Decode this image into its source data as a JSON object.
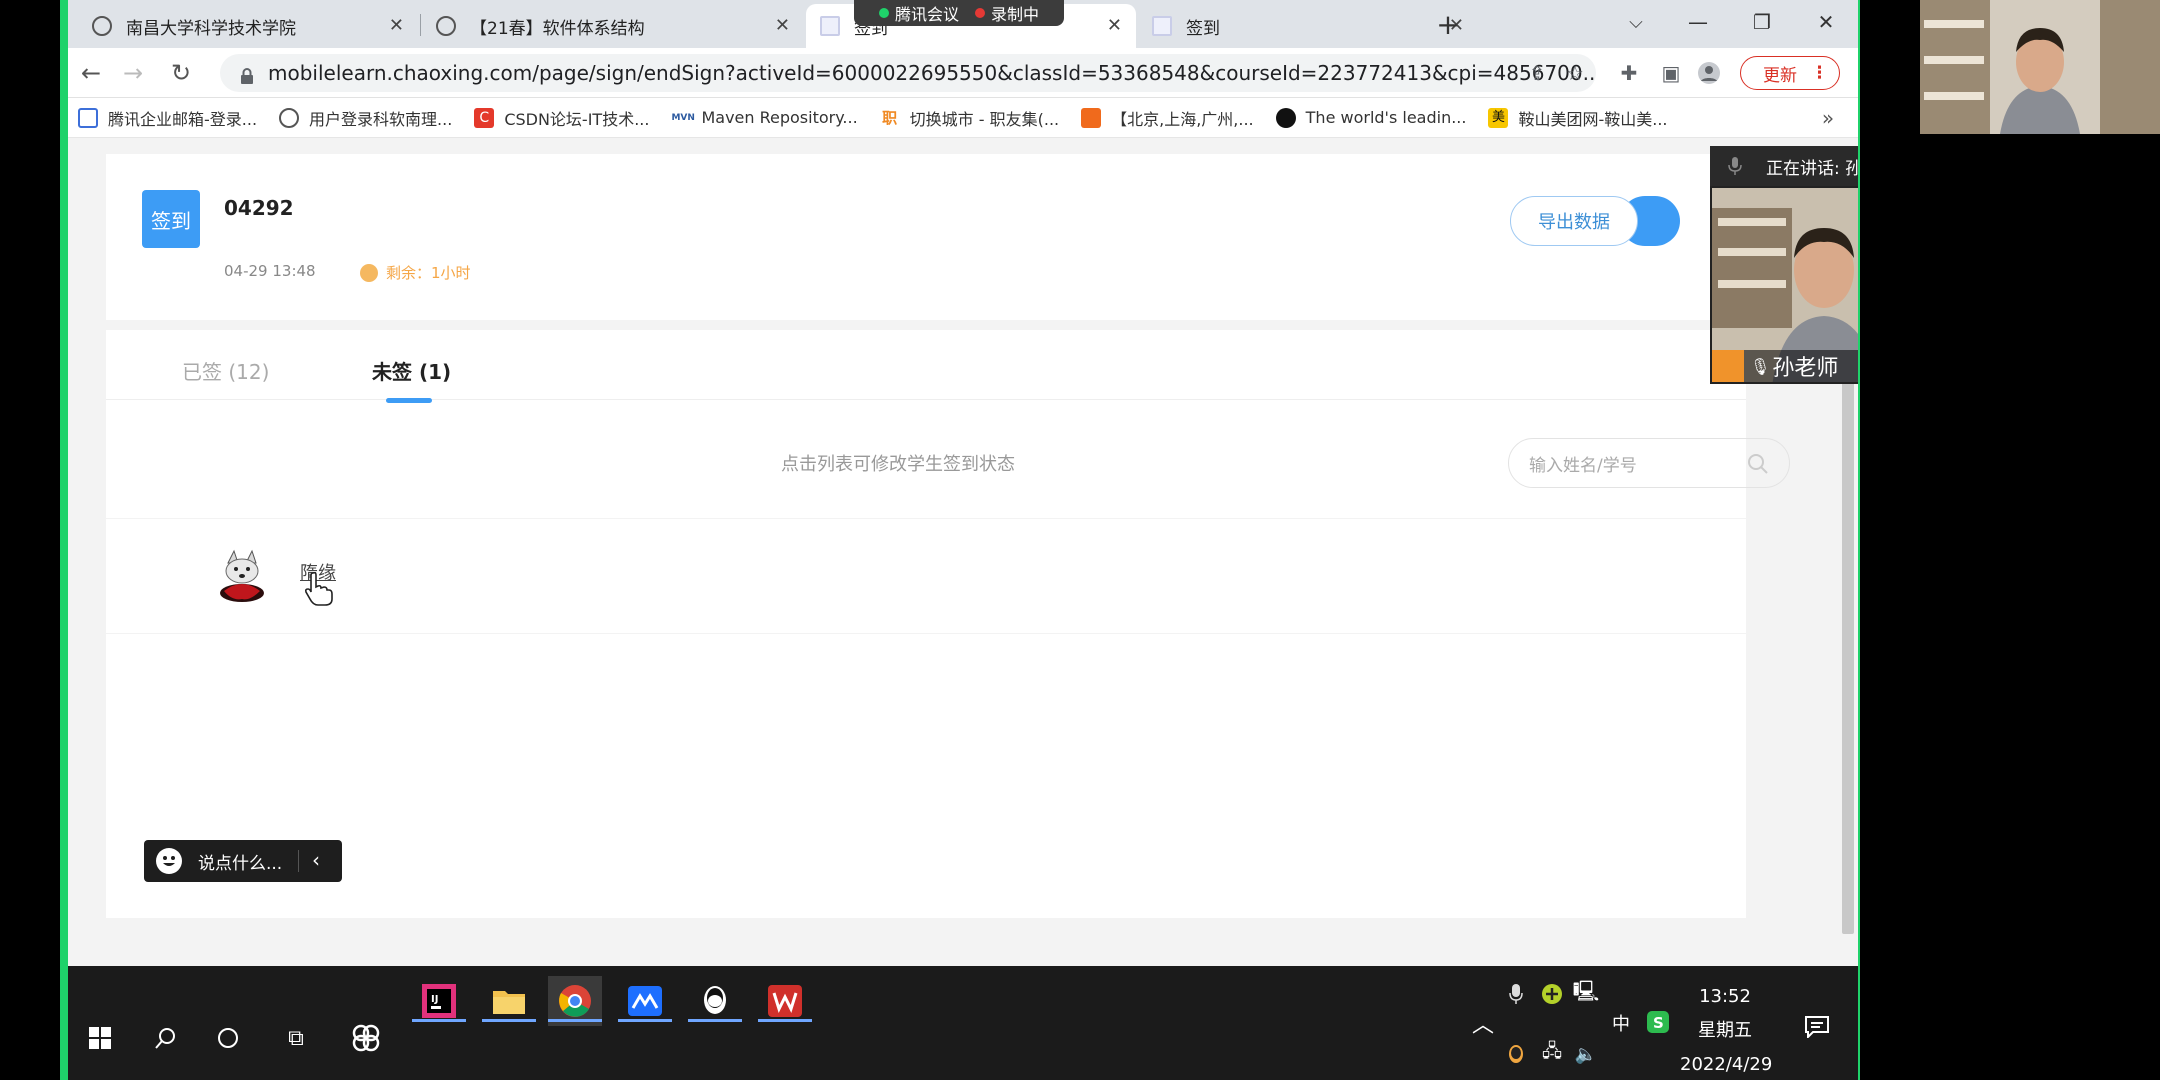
{
  "browser": {
    "tabs": [
      {
        "title": "南昌大学科学技术学院",
        "active": false
      },
      {
        "title": "【21春】软件体系结构",
        "active": false
      },
      {
        "title": "签到",
        "active": true
      },
      {
        "title": "签到",
        "active": false
      }
    ],
    "meeting_indicator": {
      "app": "腾讯会议",
      "recording": "录制中"
    },
    "url": "mobilelearn.chaoxing.com/page/sign/endSign?activeId=6000022695550&classId=53368548&courseId=223772413&cpi=4856700...",
    "update_button": "更新",
    "bookmarks": [
      {
        "label": "腾讯企业邮箱-登录...",
        "icon": "mail-icon",
        "color": "#3d6fd9"
      },
      {
        "label": "用户登录科软南理...",
        "icon": "globe-icon",
        "color": "#555555"
      },
      {
        "label": "CSDN论坛-IT技术...",
        "icon": "csdn-icon",
        "color": "#e4392b"
      },
      {
        "label": "Maven Repository...",
        "icon": "maven-icon",
        "color": "#2c5aa0"
      },
      {
        "label": "切换城市 - 职友集(...",
        "icon": "jobui-icon",
        "color": "#f08a24"
      },
      {
        "label": "【北京,上海,广州,...",
        "icon": "bookmark-orange-icon",
        "color": "#f06a1c"
      },
      {
        "label": "The world's leadin...",
        "icon": "github-icon",
        "color": "#111111"
      },
      {
        "label": "鞍山美团网-鞍山美...",
        "icon": "meituan-icon",
        "color": "#f7c600"
      }
    ]
  },
  "sign": {
    "badge": "签到",
    "code": "04292",
    "time": "04-29 13:48",
    "remaining": "剩余：1小时",
    "export_button": "导出数据"
  },
  "list": {
    "tabs": [
      {
        "label": "已签 (12)",
        "active": false
      },
      {
        "label": "未签 (1)",
        "active": true
      }
    ],
    "hint": "点击列表可修改学生签到状态",
    "search_placeholder": "输入姓名/学号",
    "students": [
      {
        "name": "隋缘",
        "avatar": "wolf-avatar"
      }
    ]
  },
  "chat": {
    "placeholder": "说点什么..."
  },
  "meeting": {
    "speaking": "正在讲话: 孙老师;",
    "participant": "孙老师"
  },
  "taskbar": {
    "time": "13:52",
    "weekday": "星期五",
    "date": "2022/4/29",
    "ime": "中"
  },
  "colors": {
    "accent": "#3d9cf5",
    "frame": "#1fd26a",
    "warning": "#f5a646",
    "update": "#d93025"
  }
}
